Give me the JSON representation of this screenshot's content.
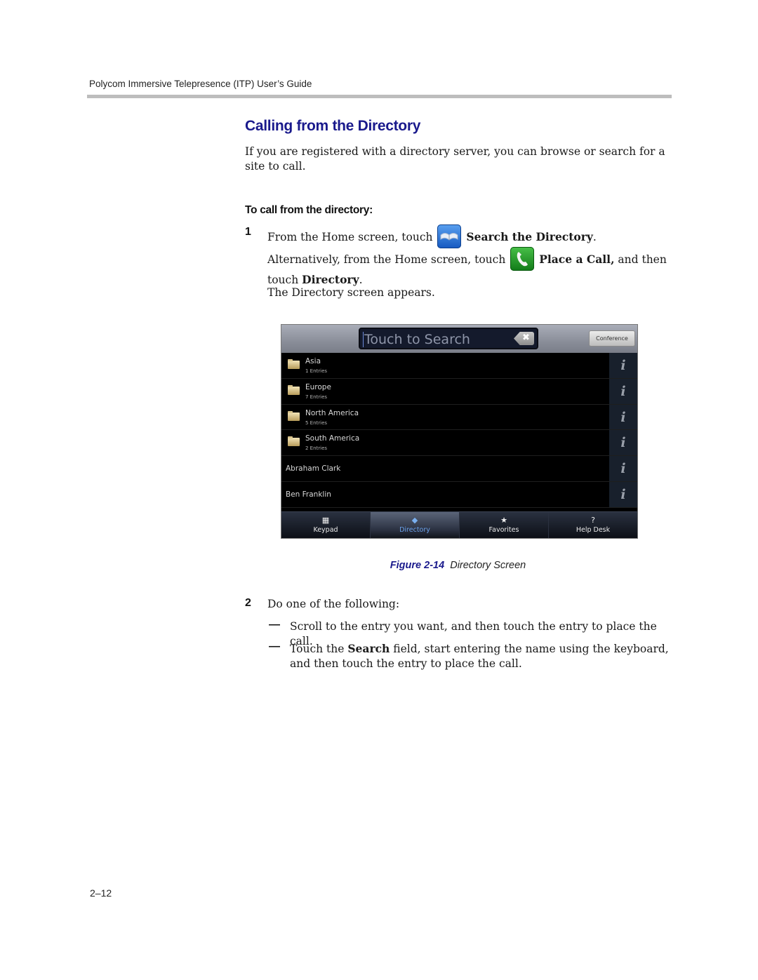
{
  "header": {
    "running_head": "Polycom Immersive Telepresence (ITP) User’s Guide"
  },
  "section": {
    "title": "Calling from the Directory",
    "intro": "If you are registered with a directory server, you can browse or search for a site to call."
  },
  "procedure": {
    "title": "To call from the directory:",
    "step1": {
      "number": "1",
      "line1_prefix": "From the Home screen, touch",
      "line1_icon": "directory-book-icon",
      "line1_bold": "Search the Directory",
      "line1_suffix": ".",
      "line2_prefix": "Alternatively, from the Home screen, touch",
      "line2_icon": "phone-handset-icon",
      "line2_bold": "Place a Call,",
      "line2_mid": " and then touch ",
      "line2_bold2": "Directory",
      "line2_suffix": ".",
      "line3": "The Directory screen appears."
    },
    "step2": {
      "number": "2",
      "text": "Do one of the following:",
      "bullets": [
        {
          "dash": "—",
          "text": "Scroll to the entry you want, and then touch the entry to place the call."
        },
        {
          "dash": "—",
          "prefix": "Touch the ",
          "bold": "Search",
          "suffix": " field, start entering the name using the keyboard, and then touch the entry to place the call."
        }
      ]
    }
  },
  "figure": {
    "number": "Figure 2-14",
    "title": "Directory Screen",
    "screen": {
      "search_placeholder": "Touch to Search",
      "clear_icon": "✖",
      "conference_label": "Conference",
      "info_glyph": "i",
      "folders": [
        {
          "name": "Asia",
          "entries": "1 Entries"
        },
        {
          "name": "Europe",
          "entries": "7 Entries"
        },
        {
          "name": "North America",
          "entries": "5 Entries"
        },
        {
          "name": "South America",
          "entries": "2 Entries"
        }
      ],
      "contacts": [
        {
          "name": "Abraham Clark"
        },
        {
          "name": "Ben Franklin"
        }
      ],
      "tabs": [
        {
          "label": "Keypad",
          "icon": "▦",
          "active": false
        },
        {
          "label": "Directory",
          "icon": "◆",
          "active": true
        },
        {
          "label": "Favorites",
          "icon": "★",
          "active": false
        },
        {
          "label": "Help Desk",
          "icon": "?",
          "active": false
        }
      ]
    }
  },
  "footer": {
    "page_number": "2–12"
  }
}
